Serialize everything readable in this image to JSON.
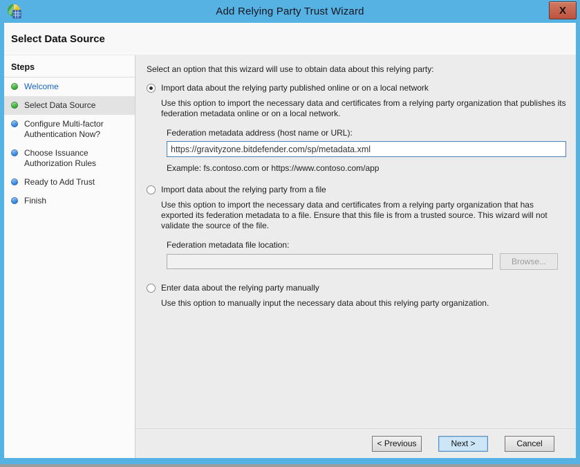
{
  "window": {
    "title": "Add Relying Party Trust Wizard",
    "close_glyph": "X"
  },
  "page": {
    "heading": "Select Data Source"
  },
  "sidebar": {
    "title": "Steps",
    "items": [
      {
        "label": "Welcome",
        "state": "done",
        "current": false
      },
      {
        "label": "Select Data Source",
        "state": "done",
        "current": true
      },
      {
        "label": "Configure Multi-factor Authentication Now?",
        "state": "todo",
        "current": false
      },
      {
        "label": "Choose Issuance Authorization Rules",
        "state": "todo",
        "current": false
      },
      {
        "label": "Ready to Add Trust",
        "state": "todo",
        "current": false
      },
      {
        "label": "Finish",
        "state": "todo",
        "current": false
      }
    ]
  },
  "main": {
    "intro": "Select an option that this wizard will use to obtain data about this relying party:",
    "options": [
      {
        "label": "Import data about the relying party published online or on a local network",
        "selected": true,
        "description": "Use this option to import the necessary data and certificates from a relying party organization that publishes its federation metadata online or on a local network.",
        "field_label": "Federation metadata address (host name or URL):",
        "field_value": "https://gravityzone.bitdefender.com/sp/metadata.xml",
        "example": "Example: fs.contoso.com or https://www.contoso.com/app"
      },
      {
        "label": "Import data about the relying party from a file",
        "selected": false,
        "description": "Use this option to import the necessary data and certificates from a relying party organization that has exported its federation metadata to a file. Ensure that this file is from a trusted source.  This wizard will not validate the source of the file.",
        "field_label": "Federation metadata file location:",
        "field_value": "",
        "browse_label": "Browse..."
      },
      {
        "label": "Enter data about the relying party manually",
        "selected": false,
        "description": "Use this option to manually input the necessary data about this relying party organization."
      }
    ]
  },
  "footer": {
    "previous_label": "< Previous",
    "next_label": "Next >",
    "cancel_label": "Cancel"
  },
  "colors": {
    "titlebar_blue": "#56b2e2",
    "close_red": "#bd5340",
    "step_done_green": "#36a33a",
    "step_todo_blue": "#2f7fd6",
    "link_blue": "#1464c8",
    "focused_input_border": "#4a7ebb",
    "default_button_fill": "#cde6f7"
  }
}
